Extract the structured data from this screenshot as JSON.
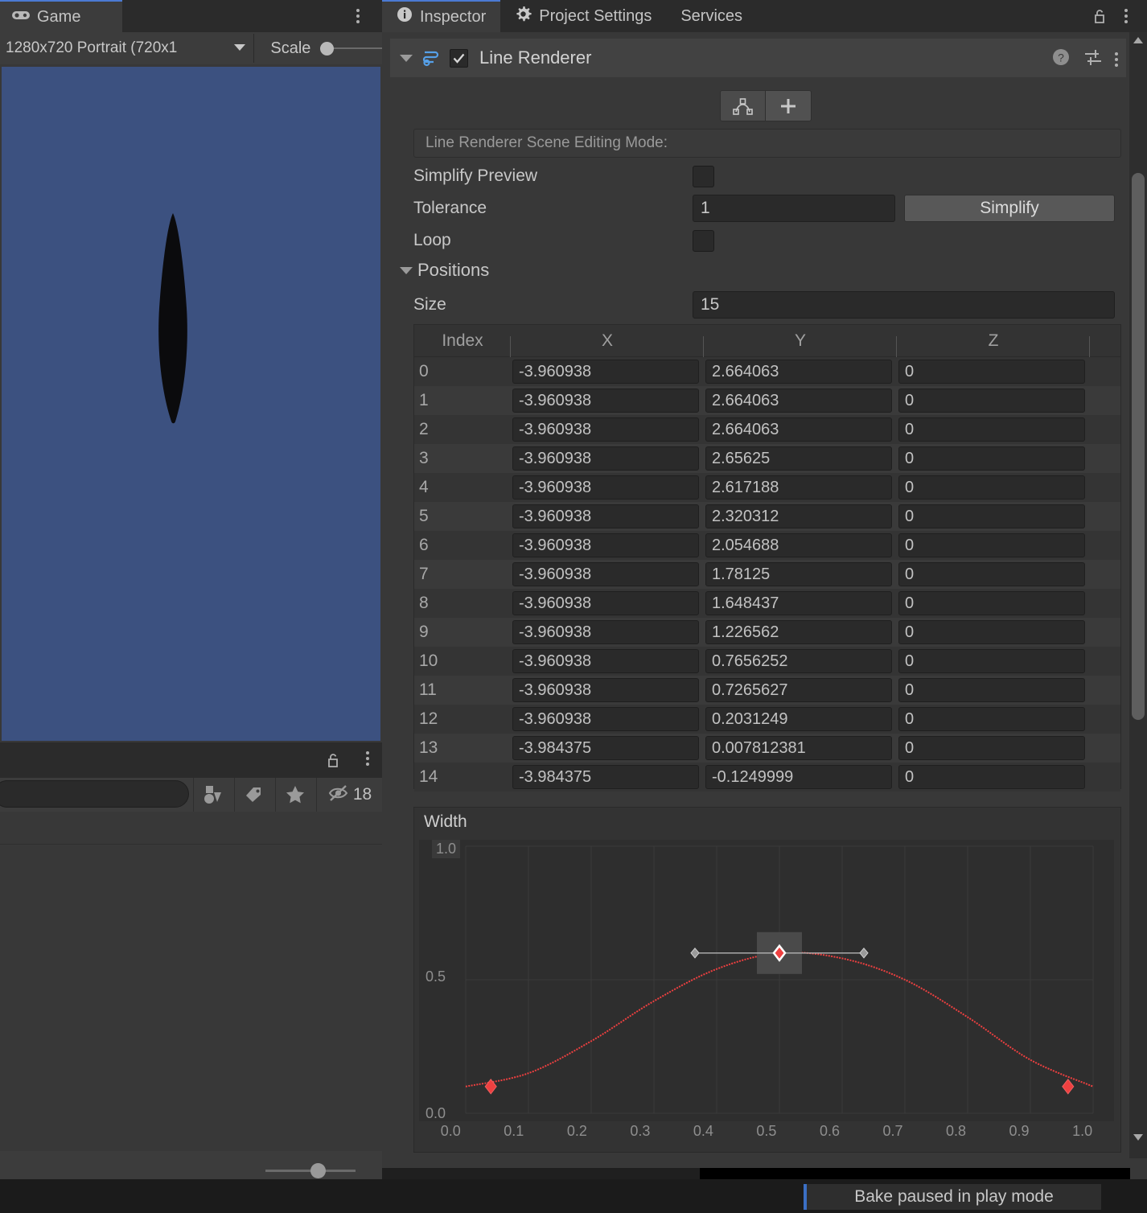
{
  "left_panel": {
    "tab": {
      "label": "Game",
      "icon": "gamepad-icon"
    },
    "menu_icon": "kebab-menu-icon",
    "resolution": "1280x720 Portrait (720x1",
    "scale": {
      "label": "Scale",
      "value": 0
    },
    "game_view": {
      "background_color": "#3c5180",
      "shape_color": "#0b0b0d"
    },
    "lock_icon": "unlock-icon",
    "search": {
      "value": "",
      "placeholder": ""
    },
    "toolbar_buttons": [
      {
        "name": "shapes-filter-icon",
        "label": ""
      },
      {
        "name": "tag-filter-icon",
        "label": ""
      },
      {
        "name": "favorite-star-icon",
        "label": ""
      },
      {
        "name": "hidden-objects-icon",
        "label": "18"
      }
    ],
    "zoom_slider_value": 50
  },
  "right_panel": {
    "tabs": [
      {
        "label": "Inspector",
        "icon": "info-icon",
        "active": true
      },
      {
        "label": "Project Settings",
        "icon": "gear-icon",
        "active": false
      },
      {
        "label": "Services",
        "icon": "",
        "active": false
      }
    ],
    "lock_icon": "unlock-icon",
    "menu_icon": "kebab-menu-icon",
    "component": {
      "title": "Line Renderer",
      "enabled": true,
      "icon": "line-renderer-icon",
      "header_icons": [
        "help-icon",
        "preset-icon",
        "kebab-menu-icon"
      ]
    },
    "mode_buttons": [
      {
        "name": "edit-points-icon",
        "label": ""
      },
      {
        "name": "add-point-icon",
        "label": ""
      }
    ],
    "scene_editing_mode_label": "Line Renderer Scene Editing Mode:",
    "fields": {
      "simplify_preview": {
        "label": "Simplify Preview",
        "checked": false
      },
      "tolerance": {
        "label": "Tolerance",
        "value": "1"
      },
      "simplify_button": "Simplify",
      "loop": {
        "label": "Loop",
        "checked": false
      }
    },
    "positions": {
      "section_label": "Positions",
      "size_label": "Size",
      "size_value": "15",
      "columns": [
        "Index",
        "X",
        "Y",
        "Z"
      ],
      "rows": [
        {
          "index": "0",
          "x": "-3.960938",
          "y": "2.664063",
          "z": "0"
        },
        {
          "index": "1",
          "x": "-3.960938",
          "y": "2.664063",
          "z": "0"
        },
        {
          "index": "2",
          "x": "-3.960938",
          "y": "2.664063",
          "z": "0"
        },
        {
          "index": "3",
          "x": "-3.960938",
          "y": "2.65625",
          "z": "0"
        },
        {
          "index": "4",
          "x": "-3.960938",
          "y": "2.617188",
          "z": "0"
        },
        {
          "index": "5",
          "x": "-3.960938",
          "y": "2.320312",
          "z": "0"
        },
        {
          "index": "6",
          "x": "-3.960938",
          "y": "2.054688",
          "z": "0"
        },
        {
          "index": "7",
          "x": "-3.960938",
          "y": "1.78125",
          "z": "0"
        },
        {
          "index": "8",
          "x": "-3.960938",
          "y": "1.648437",
          "z": "0"
        },
        {
          "index": "9",
          "x": "-3.960938",
          "y": "1.226562",
          "z": "0"
        },
        {
          "index": "10",
          "x": "-3.960938",
          "y": "0.7656252",
          "z": "0"
        },
        {
          "index": "11",
          "x": "-3.960938",
          "y": "0.7265627",
          "z": "0"
        },
        {
          "index": "12",
          "x": "-3.960938",
          "y": "0.2031249",
          "z": "0"
        },
        {
          "index": "13",
          "x": "-3.984375",
          "y": "0.007812381",
          "z": "0"
        },
        {
          "index": "14",
          "x": "-3.984375",
          "y": "-0.1249999",
          "z": "0"
        }
      ]
    },
    "width_curve": {
      "title": "Width",
      "y_labels": [
        "1.0",
        "0.5",
        "0.0"
      ],
      "x_labels": [
        "0.0",
        "0.1",
        "0.2",
        "0.3",
        "0.4",
        "0.5",
        "0.6",
        "0.7",
        "0.8",
        "0.9",
        "1.0"
      ],
      "curve_color": "#ef4040"
    }
  },
  "chart_data": {
    "type": "line",
    "title": "Width",
    "xlabel": "",
    "ylabel": "",
    "xlim": [
      0.0,
      1.0
    ],
    "ylim": [
      0.0,
      1.0
    ],
    "grid": true,
    "x": [
      0.0,
      0.1,
      0.2,
      0.3,
      0.4,
      0.5,
      0.6,
      0.7,
      0.8,
      0.9,
      1.0
    ],
    "values": [
      0.1,
      0.15,
      0.27,
      0.42,
      0.54,
      0.6,
      0.58,
      0.5,
      0.36,
      0.2,
      0.1
    ],
    "keyframes": [
      {
        "time": 0.04,
        "value": 0.1,
        "selected": false
      },
      {
        "time": 0.5,
        "value": 0.6,
        "selected": true
      },
      {
        "time": 0.96,
        "value": 0.1,
        "selected": false
      }
    ],
    "x_tick_labels": [
      "0.0",
      "0.1",
      "0.2",
      "0.3",
      "0.4",
      "0.5",
      "0.6",
      "0.7",
      "0.8",
      "0.9",
      "1.0"
    ],
    "y_tick_labels": [
      "1.0",
      "0.5",
      "0.0"
    ],
    "series": [
      {
        "name": "Width",
        "values": [
          0.1,
          0.15,
          0.27,
          0.42,
          0.54,
          0.6,
          0.58,
          0.5,
          0.36,
          0.2,
          0.1
        ]
      }
    ]
  },
  "status_bar": {
    "message": "Bake paused in play mode"
  }
}
